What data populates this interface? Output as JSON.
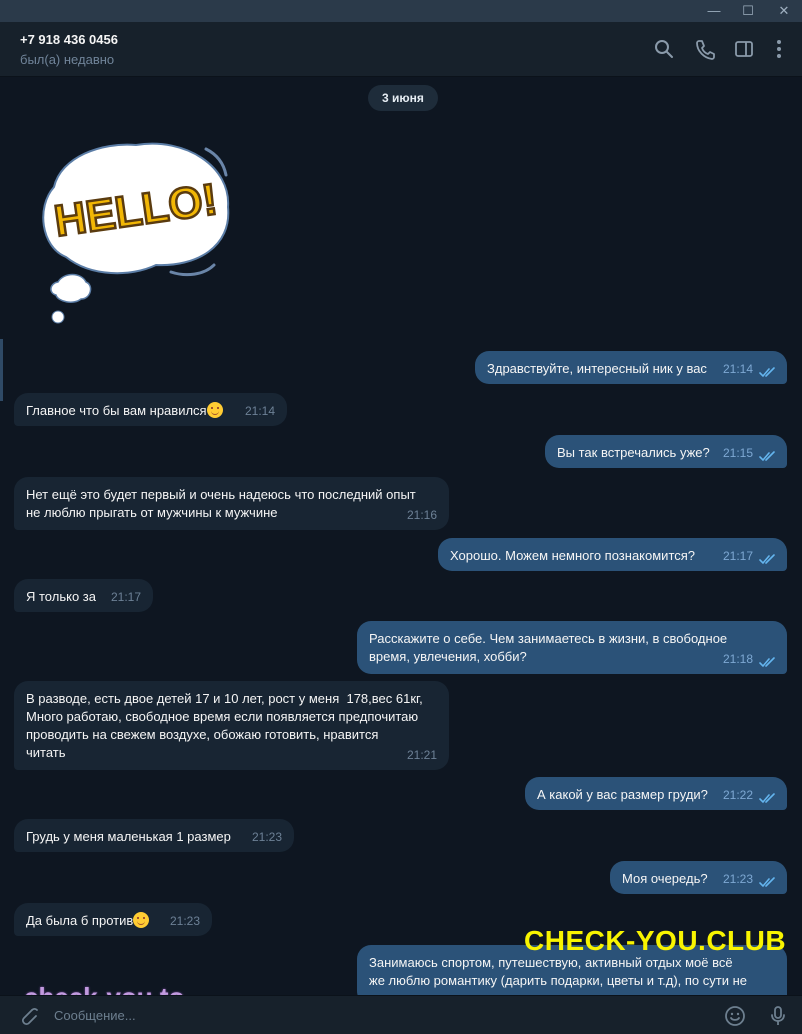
{
  "window": {
    "minimize_glyph": "—",
    "maximize_glyph": "☐",
    "close_glyph": "✕"
  },
  "header": {
    "contact_name": "+7 918 436 0456",
    "status": "был(а) недавно",
    "icons": [
      "search-icon",
      "phone-icon",
      "sidebar-toggle-icon",
      "more-icon"
    ]
  },
  "chat": {
    "date_label": "3 июня",
    "sticker_text": "HELLO!",
    "messages": [
      {
        "dir": "out",
        "text": "Здравствуйте, интересный ник у вас",
        "time": "21:14"
      },
      {
        "dir": "in",
        "text": "Главное что бы вам нравился",
        "emoji": "smile",
        "time": "21:14"
      },
      {
        "dir": "out",
        "text": "Вы так встречались уже?",
        "time": "21:15"
      },
      {
        "dir": "in",
        "text": "Нет ещё это будет первый и очень надеюсь что последний опыт\nне люблю прыгать от мужчины к мужчине",
        "time": "21:16"
      },
      {
        "dir": "out",
        "text": "Хорошо. Можем немного познакомится?",
        "time": "21:17"
      },
      {
        "dir": "in",
        "text": "Я только за",
        "time": "21:17"
      },
      {
        "dir": "out",
        "text": "Расскажите о себе. Чем занимаетесь в жизни, в свободное\nвремя, увлечения, хобби?",
        "time": "21:18"
      },
      {
        "dir": "in",
        "text": "В разводе, есть двое детей 17 и 10 лет, рост у меня  178,вес 61кг,\nМного работаю, свободное время если появляется предпочитаю\nпроводить на свежем воздухе, обожаю готовить, нравится\nчитать",
        "time": "21:21"
      },
      {
        "dir": "out",
        "text": "А какой у вас размер груди?",
        "time": "21:22"
      },
      {
        "dir": "in",
        "text": "Грудь у меня маленькая 1 размер",
        "time": "21:23"
      },
      {
        "dir": "out",
        "text": "Моя очередь?",
        "time": "21:23"
      },
      {
        "dir": "in",
        "text": "Да была б против",
        "emoji": "smile",
        "time": "21:23"
      },
      {
        "dir": "out",
        "text": "Занимаюсь спортом, путешествую, активный отдых моё всё\nже люблю романтику (дарить подарки, цветы и т.д), по сути не",
        "time": ""
      }
    ]
  },
  "watermarks": {
    "top": "CHECK-YOU.CLUB",
    "bottom": "check-you.to"
  },
  "composer": {
    "placeholder": "Сообщение...",
    "icons": [
      "attach-icon",
      "emoji-icon",
      "microphone-icon"
    ]
  },
  "colors": {
    "background": "#0e1621",
    "header": "#17212b",
    "incoming_bubble": "#182533",
    "outgoing_bubble": "#2b5278",
    "read_tick": "#64b5ef",
    "watermark_yellow": "#f8f400",
    "watermark_purple": "#c29adf"
  }
}
